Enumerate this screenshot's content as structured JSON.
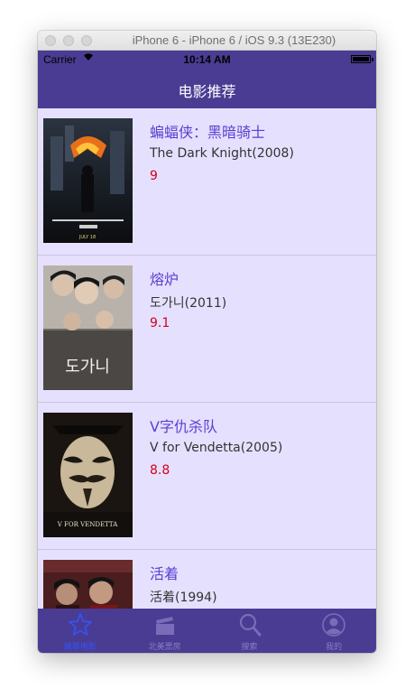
{
  "window": {
    "title": "iPhone 6 - iPhone 6 / iOS 9.3 (13E230)"
  },
  "status_bar": {
    "carrier": "Carrier",
    "time": "10:14 AM"
  },
  "nav": {
    "title": "电影推荐"
  },
  "movies": [
    {
      "title": "蝙蝠侠：黑暗骑士",
      "original": "The Dark Knight(2008)",
      "rating": "9",
      "poster_text": "THE DARK KNIGHT",
      "poster_date": "JULY 18"
    },
    {
      "title": "熔炉",
      "original": "도가니(2011)",
      "rating": "9.1",
      "poster_text": "도가니"
    },
    {
      "title": "V字仇杀队",
      "original": "V for Vendetta(2005)",
      "rating": "8.8",
      "poster_text": "V FOR VENDETTA"
    },
    {
      "title": "活着",
      "original": "活着(1994)",
      "rating": ""
    }
  ],
  "tabs": [
    {
      "label": "推荐电影",
      "icon": "star-icon",
      "active": true
    },
    {
      "label": "北美票房",
      "icon": "clapperboard-icon",
      "active": false
    },
    {
      "label": "搜索",
      "icon": "search-icon",
      "active": false
    },
    {
      "label": "我的",
      "icon": "user-icon",
      "active": false
    }
  ],
  "colors": {
    "nav_background": "#4b3c93",
    "list_background": "#e6e0ff",
    "title_text": "#5a3fd0",
    "rating_text": "#d0021b",
    "active_tab": "#2f55ff"
  }
}
